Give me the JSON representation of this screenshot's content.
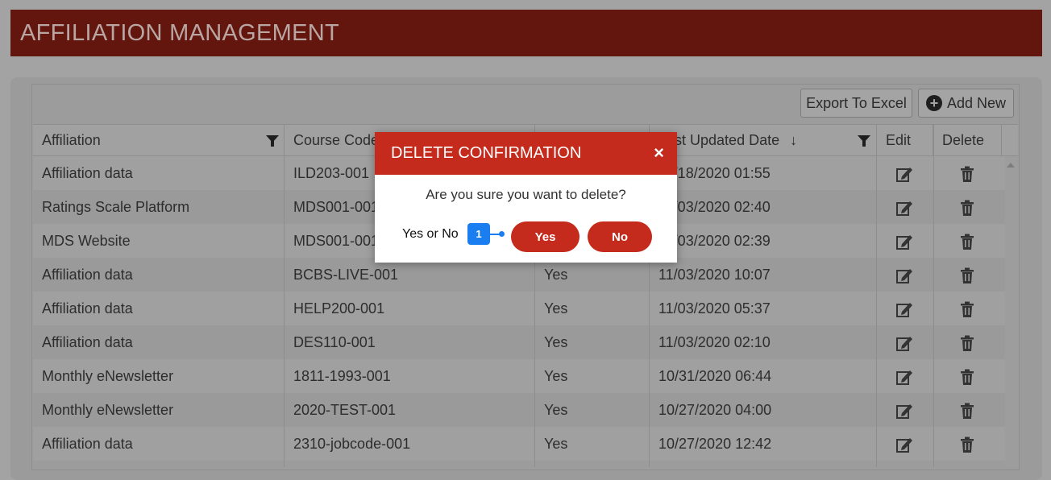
{
  "page": {
    "title": "AFFILIATION MANAGEMENT"
  },
  "toolbar": {
    "export_label": "Export To Excel",
    "add_new_label": "Add New"
  },
  "table": {
    "columns": [
      "Affiliation",
      "Course Code",
      "",
      "Last Updated Date",
      "Edit",
      "Delete"
    ],
    "rows": [
      {
        "affiliation": "Affiliation data",
        "course_code": "ILD203-001",
        "active": "",
        "updated": "11/18/2020 01:55"
      },
      {
        "affiliation": "Ratings Scale Platform",
        "course_code": "MDS001-001",
        "active": "",
        "updated": "11/03/2020 02:40"
      },
      {
        "affiliation": "MDS Website",
        "course_code": "MDS001-001",
        "active": "",
        "updated": "11/03/2020 02:39"
      },
      {
        "affiliation": "Affiliation data",
        "course_code": "BCBS-LIVE-001",
        "active": "Yes",
        "updated": "11/03/2020 10:07"
      },
      {
        "affiliation": "Affiliation data",
        "course_code": "HELP200-001",
        "active": "Yes",
        "updated": "11/03/2020 05:37"
      },
      {
        "affiliation": "Affiliation data",
        "course_code": "DES110-001",
        "active": "Yes",
        "updated": "11/03/2020 02:10"
      },
      {
        "affiliation": "Monthly eNewsletter",
        "course_code": "1811-1993-001",
        "active": "Yes",
        "updated": "10/31/2020 06:44"
      },
      {
        "affiliation": "Monthly eNewsletter",
        "course_code": "2020-TEST-001",
        "active": "Yes",
        "updated": "10/27/2020 04:00"
      },
      {
        "affiliation": "Affiliation data",
        "course_code": "2310-jobcode-001",
        "active": "Yes",
        "updated": "10/27/2020 12:42"
      }
    ],
    "sort_indicator": "↓"
  },
  "dialog": {
    "title": "DELETE CONFIRMATION",
    "close_glyph": "×",
    "message": "Are you sure you want to delete?",
    "annotation_label": "Yes or No",
    "annotation_badge": "1",
    "yes_label": "Yes",
    "no_label": "No"
  },
  "colors": {
    "header": "#62160e",
    "dialog_accent": "#c42b1c",
    "badge": "#1a7ef0"
  }
}
